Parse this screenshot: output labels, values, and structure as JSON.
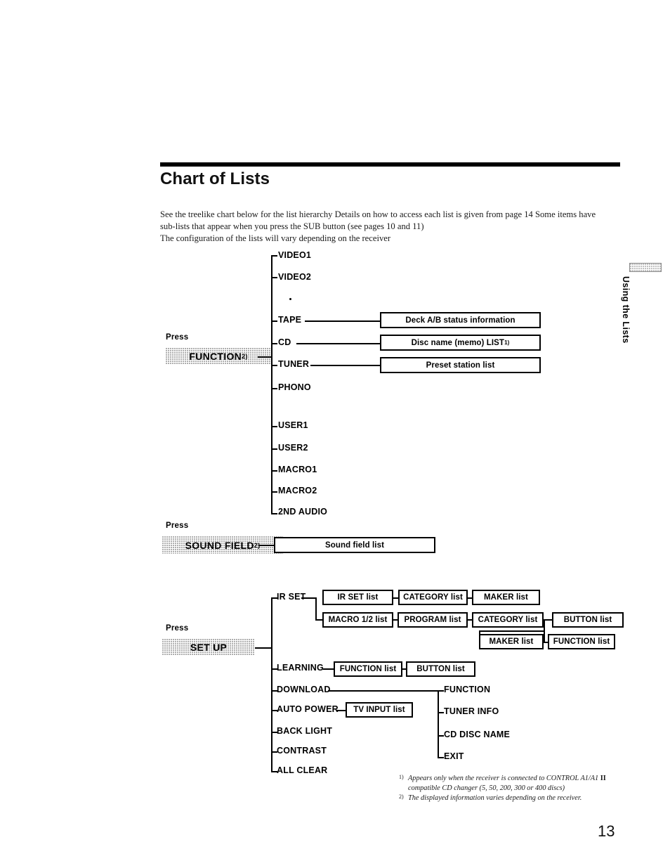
{
  "header": {
    "title": "Chart of Lists"
  },
  "intro": {
    "line1": "See the treelike chart below for the list hierarchy  Details on how to access each list is given from page 14  Some items have",
    "line2": "sub-lists that appear when you press the SUB button (see pages 10 and 11)",
    "line3": "The configuration of the lists will vary depending on the receiver"
  },
  "function_section": {
    "press_label": "Press",
    "key_label": "FUNCTION",
    "key_footnote": "2)",
    "nodes": [
      "VIDEO1",
      "VIDEO2",
      "TAPE",
      "CD",
      "TUNER",
      "PHONO",
      "USER1",
      "USER2",
      "MACRO1",
      "MACRO2",
      "2ND AUDIO"
    ],
    "boxes": {
      "tape": "Deck A/B status information",
      "cd": "Disc name (memo) LIST",
      "cd_footnote": "1)",
      "tuner": "Preset station list"
    }
  },
  "sound_field_section": {
    "press_label": "Press",
    "key_label": "SOUND FIELD",
    "key_footnote": "2)",
    "box": "Sound field list"
  },
  "setup_section": {
    "press_label": "Press",
    "key_label": "SET UP",
    "nodes": [
      "IR SET",
      "LEARNING",
      "DOWNLOAD",
      "AUTO POWER",
      "BACK LIGHT",
      "CONTRAST",
      "ALL CLEAR"
    ],
    "ir_set": {
      "row1": [
        "IR SET list",
        "CATEGORY list",
        "MAKER list"
      ],
      "row2": [
        "MACRO 1/2 list",
        "PROGRAM list",
        "CATEGORY list",
        "BUTTON list"
      ],
      "row3": [
        "MAKER list",
        "FUNCTION list"
      ]
    },
    "learning": [
      "FUNCTION list",
      "BUTTON list"
    ],
    "auto_power": "TV INPUT list",
    "download": [
      "FUNCTION",
      "TUNER INFO",
      "CD DISC NAME",
      "EXIT"
    ]
  },
  "footnotes": {
    "marker1": "1)",
    "note1_a": "Appears only when the receiver is connected to CONTROL A1/A1 ",
    "note1_roman": "II",
    "note1_b": "compatible CD changer (5, 50, 200, 300 or 400 discs)",
    "marker2": "2)",
    "note2": "The displayed information varies depending on the receiver."
  },
  "side_tab": {
    "label": "Using the Lists"
  },
  "folio": {
    "page_number": "13"
  }
}
